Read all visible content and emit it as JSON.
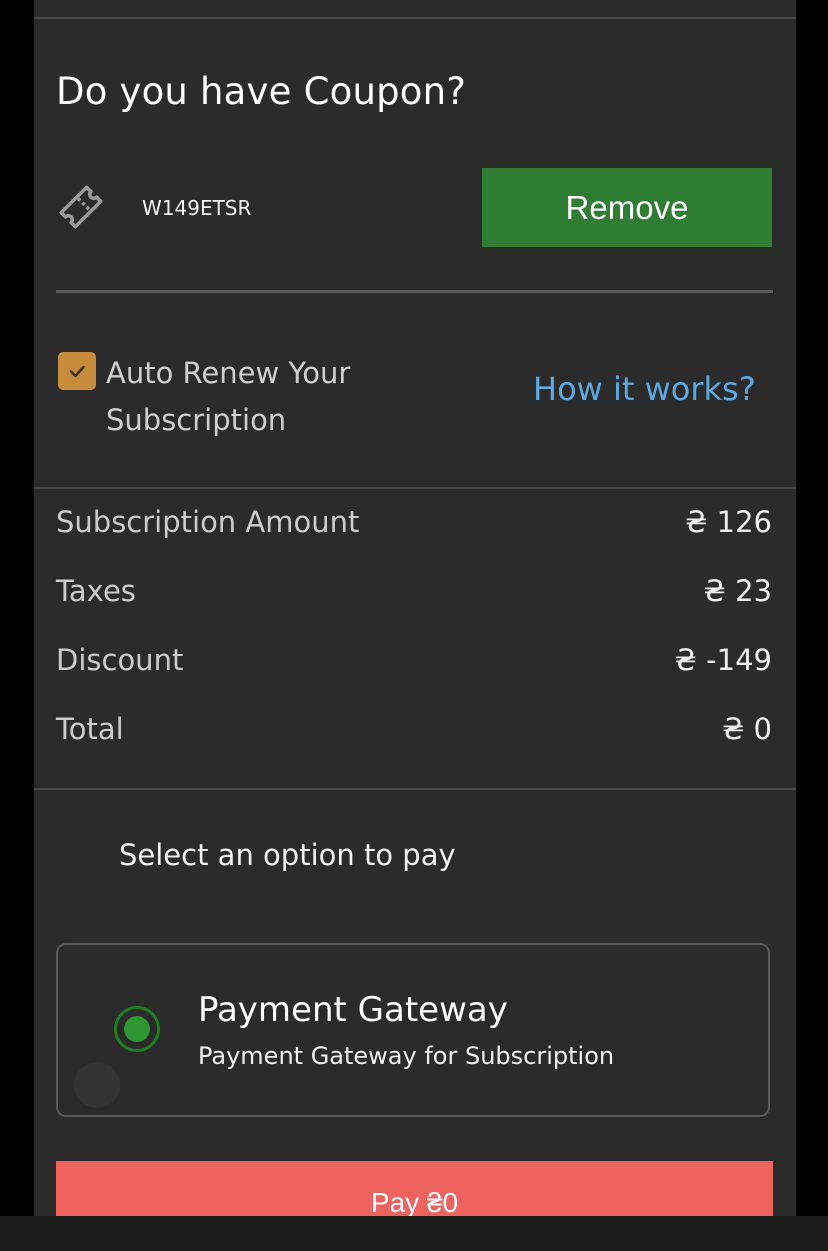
{
  "coupon": {
    "title": "Do you have Coupon?",
    "code": "W149ETSR",
    "remove_label": "Remove",
    "icon": "ticket-icon"
  },
  "auto_renew": {
    "checked": true,
    "label": "Auto Renew Your Subscription",
    "how_it_works_label": "How it works?"
  },
  "summary": {
    "rows": [
      {
        "label": "Subscription Amount",
        "value": "₴ 126"
      },
      {
        "label": "Taxes",
        "value": "₴ 23"
      },
      {
        "label": "Discount",
        "value": "₴ -149"
      },
      {
        "label": "Total",
        "value": "₴ 0"
      }
    ]
  },
  "payment": {
    "select_title": "Select an option to pay",
    "options": [
      {
        "title": "Payment Gateway",
        "subtitle": "Payment Gateway for Subscription",
        "selected": true
      }
    ],
    "pay_label": "Pay ₴0"
  },
  "colors": {
    "panel_bg": "#2b2b2b",
    "remove_button": "#2e7d32",
    "checkbox": "#c78d3d",
    "link": "#5fa8de",
    "pay_button": "#ee6360",
    "radio_selected": "#2e9633"
  }
}
